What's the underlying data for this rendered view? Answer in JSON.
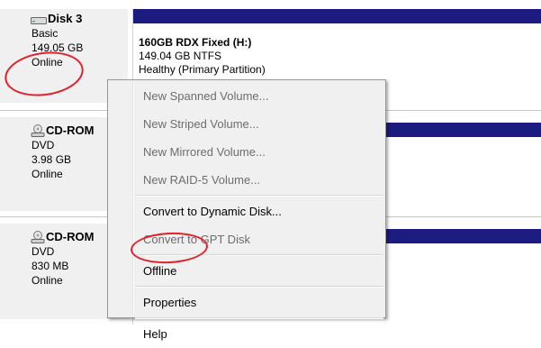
{
  "disks": [
    {
      "name": "Disk 3",
      "type": "Basic",
      "size": "149.05 GB",
      "status": "Online",
      "icon": "hard-disk-icon",
      "volume": {
        "name": "160GB RDX Fixed  (H:)",
        "size_fs": "149.04 GB NTFS",
        "status": "Healthy (Primary Partition)"
      }
    },
    {
      "name": "CD-ROM",
      "type": "DVD",
      "size": "3.98 GB",
      "status": "Online",
      "icon": "cd-rom-icon"
    },
    {
      "name": "CD-ROM",
      "type": "DVD",
      "size": "830 MB",
      "status": "Online",
      "icon": "cd-rom-icon"
    }
  ],
  "context_menu": {
    "items": [
      {
        "label": "New Spanned Volume...",
        "enabled": false
      },
      {
        "label": "New Striped Volume...",
        "enabled": false
      },
      {
        "label": "New Mirrored Volume...",
        "enabled": false
      },
      {
        "label": "New RAID-5 Volume...",
        "enabled": false
      },
      {
        "label": "Convert to Dynamic Disk...",
        "enabled": true
      },
      {
        "label": "Convert to GPT Disk",
        "enabled": false
      },
      {
        "label": "Offline",
        "enabled": true
      },
      {
        "label": "Properties",
        "enabled": true
      },
      {
        "label": "Help",
        "enabled": true
      }
    ]
  },
  "colors": {
    "volume_bar": "#1c1c80",
    "annotation": "#e0202a"
  }
}
